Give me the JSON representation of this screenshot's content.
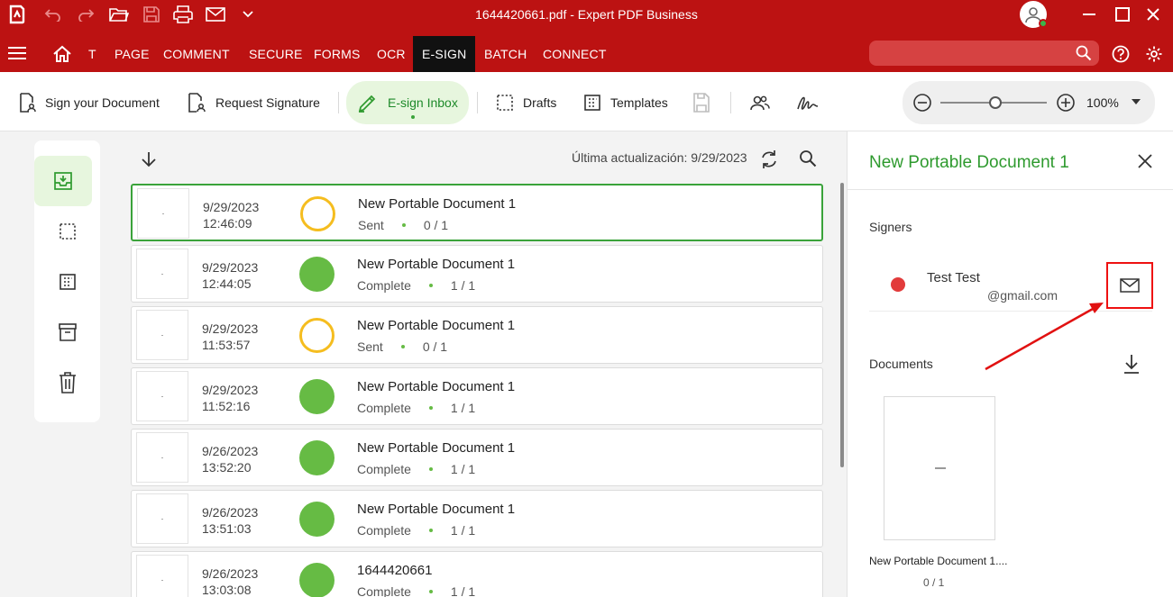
{
  "window": {
    "title": "1644420661.pdf   -   Expert PDF Business"
  },
  "menu": {
    "items": [
      "T",
      "PAGE",
      "COMMENT",
      "SECURE",
      "FORMS",
      "OCR",
      "E-SIGN",
      "BATCH",
      "CONNECT"
    ],
    "active": "E-SIGN",
    "search_placeholder": ""
  },
  "toolbar": {
    "sign_doc": "Sign your Document",
    "request_sig": "Request Signature",
    "inbox": "E-sign Inbox",
    "drafts": "Drafts",
    "templates": "Templates",
    "zoom": "100%"
  },
  "list": {
    "last_update": "Última actualización: 9/29/2023",
    "rows": [
      {
        "date": "9/29/2023",
        "time": "12:46:09",
        "status": "sent",
        "name": "New Portable Document 1",
        "state": "Sent",
        "count": "0 / 1"
      },
      {
        "date": "9/29/2023",
        "time": "12:44:05",
        "status": "complete",
        "name": "New Portable Document 1",
        "state": "Complete",
        "count": "1 / 1"
      },
      {
        "date": "9/29/2023",
        "time": "11:53:57",
        "status": "sent",
        "name": "New Portable Document 1",
        "state": "Sent",
        "count": "0 / 1"
      },
      {
        "date": "9/29/2023",
        "time": "11:52:16",
        "status": "complete",
        "name": "New Portable Document 1",
        "state": "Complete",
        "count": "1 / 1"
      },
      {
        "date": "9/26/2023",
        "time": "13:52:20",
        "status": "complete",
        "name": "New Portable Document 1",
        "state": "Complete",
        "count": "1 / 1"
      },
      {
        "date": "9/26/2023",
        "time": "13:51:03",
        "status": "complete",
        "name": "New Portable Document 1",
        "state": "Complete",
        "count": "1 / 1"
      },
      {
        "date": "9/26/2023",
        "time": "13:03:08",
        "status": "complete",
        "name": "1644420661",
        "state": "Complete",
        "count": "1 / 1"
      }
    ]
  },
  "panel": {
    "title": "New Portable Document 1",
    "signers_label": "Signers",
    "signer_name": "Test Test",
    "signer_email": "@gmail.com",
    "documents_label": "Documents",
    "doc_name": "New Portable Document 1....",
    "doc_count": "0 / 1"
  },
  "colors": {
    "brand_red": "#bc1212",
    "accent_green": "#2e9a2e",
    "sent_yellow": "#f5bd1f",
    "complete_green": "#66bb44",
    "annotation_red": "#e11111"
  }
}
